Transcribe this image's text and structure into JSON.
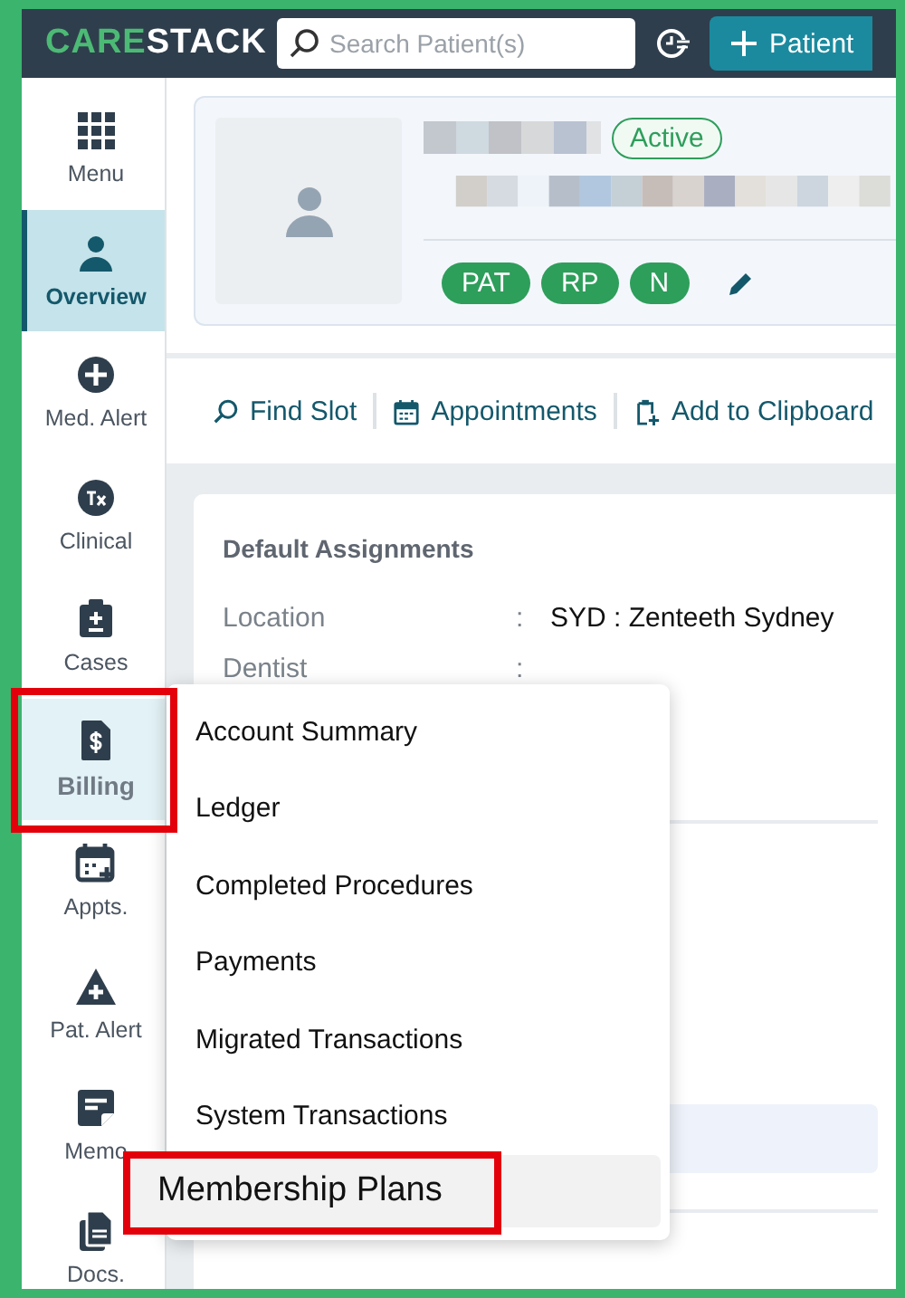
{
  "header": {
    "logo": [
      "CARE",
      "STACK"
    ],
    "search": {
      "placeholder": "Search Patient(s)"
    },
    "add_button": "Patient"
  },
  "sidebar": {
    "items": [
      {
        "label": "Menu",
        "kind": "grid",
        "selected": false,
        "outlined": false
      },
      {
        "label": "Overview",
        "kind": "person",
        "selected": true,
        "outlined": false
      },
      {
        "label": "Med. Alert",
        "kind": "plus",
        "selected": false,
        "outlined": false
      },
      {
        "label": "Clinical",
        "kind": "tx",
        "selected": false,
        "outlined": false
      },
      {
        "label": "Cases",
        "kind": "case",
        "selected": false,
        "outlined": false
      },
      {
        "label": "Billing",
        "kind": "bill",
        "selected": false,
        "outlined": true
      },
      {
        "label": "Appts.",
        "kind": "calendar",
        "selected": false,
        "outlined": false
      },
      {
        "label": "Pat. Alert",
        "kind": "alert",
        "selected": false,
        "outlined": false
      },
      {
        "label": "Memo",
        "kind": "memo",
        "selected": false,
        "outlined": false
      },
      {
        "label": "Docs.",
        "kind": "docs",
        "selected": false,
        "outlined": false
      }
    ]
  },
  "patient": {
    "status": "Active",
    "tags": [
      "PAT",
      "RP",
      "N"
    ]
  },
  "actions": [
    {
      "label": "Find Slot",
      "kind": "search"
    },
    {
      "label": "Appointments",
      "kind": "calendar"
    },
    {
      "label": "Add to Clipboard",
      "kind": "clipboard"
    }
  ],
  "assignments": {
    "title": "Default Assignments",
    "rows": [
      {
        "label": "Location",
        "separator": ":",
        "value": "SYD : Zenteeth Sydney"
      },
      {
        "label": "Dentist",
        "separator": ":"
      }
    ]
  },
  "billing_menu": {
    "items": [
      {
        "label": "Account Summary",
        "selected": false,
        "outlined": false
      },
      {
        "label": "Ledger",
        "selected": false,
        "outlined": false
      },
      {
        "label": "Completed Procedures",
        "selected": false,
        "outlined": false
      },
      {
        "label": "Payments",
        "selected": false,
        "outlined": false
      },
      {
        "label": "Migrated Transactions",
        "selected": false,
        "outlined": false
      },
      {
        "label": "System Transactions",
        "selected": false,
        "outlined": false
      },
      {
        "label": "Membership Plans",
        "selected": true,
        "outlined": true
      }
    ]
  }
}
